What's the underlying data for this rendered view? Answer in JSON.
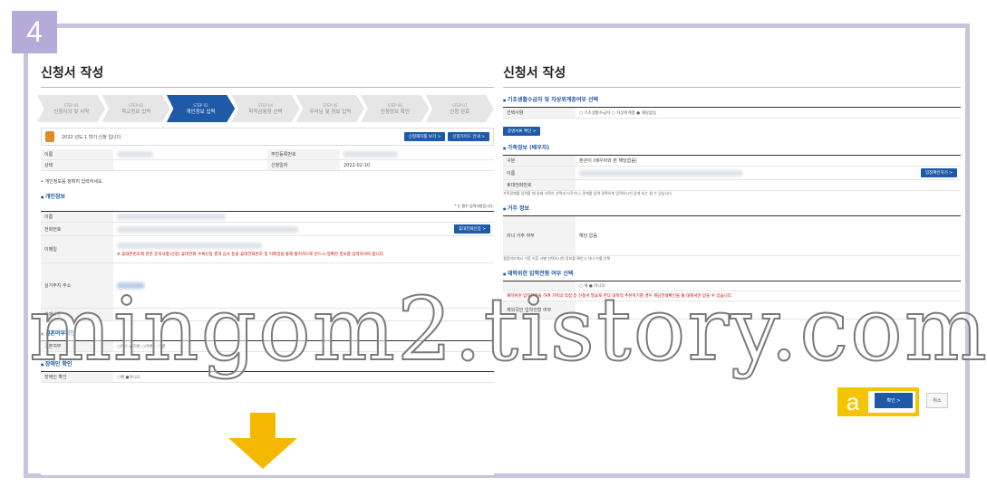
{
  "step_badge": "4",
  "left": {
    "title": "신청서 작성",
    "steps": [
      {
        "num": "STEP 01",
        "label": "신청자의 및 서약"
      },
      {
        "num": "STEP 02",
        "label": "학교정보 입력"
      },
      {
        "num": "STEP 03",
        "label": "개인정보 입력"
      },
      {
        "num": "STEP 04",
        "label": "학적금융정 선택"
      },
      {
        "num": "STEP 05",
        "label": "우리님 및 정보 입력"
      },
      {
        "num": "STEP 06",
        "label": "신청정보 확인"
      },
      {
        "num": "STEP 07",
        "label": "신청 완료"
      }
    ],
    "notice": "2022 년도 1 학기 신청 입니다.",
    "notice_btn1": "신청해지를 보기 >",
    "notice_btn2": "신청가이드 안내 >",
    "info_rows": {
      "name": "이름",
      "resident": "주민등록번호",
      "status": "상태",
      "date_label": "신청일자",
      "date": "2022-02-10"
    },
    "personal_note": "• 개인정보를 정확히 입력하세요.",
    "personal_title": "개인정보",
    "required_note": "* 는 필수 입력사항입니다.",
    "fields": {
      "name": "이름",
      "phone": "전화번호",
      "email": "이메일",
      "address": "실거주지 주소",
      "extra": "기재사항"
    },
    "phone_btn": "휴대전화인증 >",
    "email_warning": "※ 휴대폰번호에 관한 문의사항(신청) 휴대전화 수록신청 결과 심사 등을 휴대전화번호 및 이메일을 통해 통지하므로 반드시 정확한 정보를 입력하셔야 합니다.",
    "marriage_title": "결혼여부확인",
    "marriage_label": "결혼여부",
    "marriage_options": "○미혼 ●기혼 ○이혼 ○사별",
    "disability_title": "장애인 확인",
    "disability_label": "장애인 확인",
    "disability_options": "○예 ●아니오"
  },
  "right": {
    "title": "신청서 작성",
    "basic_title": "기초생활수급자 및 차상위계층여부 선택",
    "basic_label": "선택사항",
    "basic_options": "○ 기초생활수급자 ○ 차상위계층 ● 해당없음",
    "basic_btn": "증명서류 확인 >",
    "guardian_title": "가족정보 (배우자)",
    "guardian_rows": {
      "type": "구분",
      "type_val": "본관이 (배우자와 본 해당없음)",
      "name": "이름",
      "phone": "휴대전화번호"
    },
    "guardian_btn": "입정확인하기 >",
    "guardian_note": "가족관계를 입력할 때 실제 가족이 선택과 다르거나, 관계를 입력 정확하게 입력하시지 않게 되는 될 수 있습니다.",
    "residence_title": "거주 정보",
    "residence_label": "자녀 거주 여부",
    "residence_select": "해당 없음",
    "residence_note": "결혼여부에서 기혼 이혼 사별 선택하시면 정보를 확인시 자녀 수를 선택",
    "disability_title": "재학위한 입학전형 여부 선택",
    "disability_options": "○ 예 ● 아니오",
    "disability_warning": "재학위한 입학전형을 하여 가족의 직접 증 신청서 필요로 한다 대학적 추천학기를 경우 해당전형확인을 통 대해서만 받을 수 있습니다.",
    "disability_label": "재외국민 입학전형 여부",
    "confirm_btn": "확인 >",
    "cancel_btn": "취소"
  },
  "watermark": "mingom2.tistory.com",
  "a_label": "a"
}
